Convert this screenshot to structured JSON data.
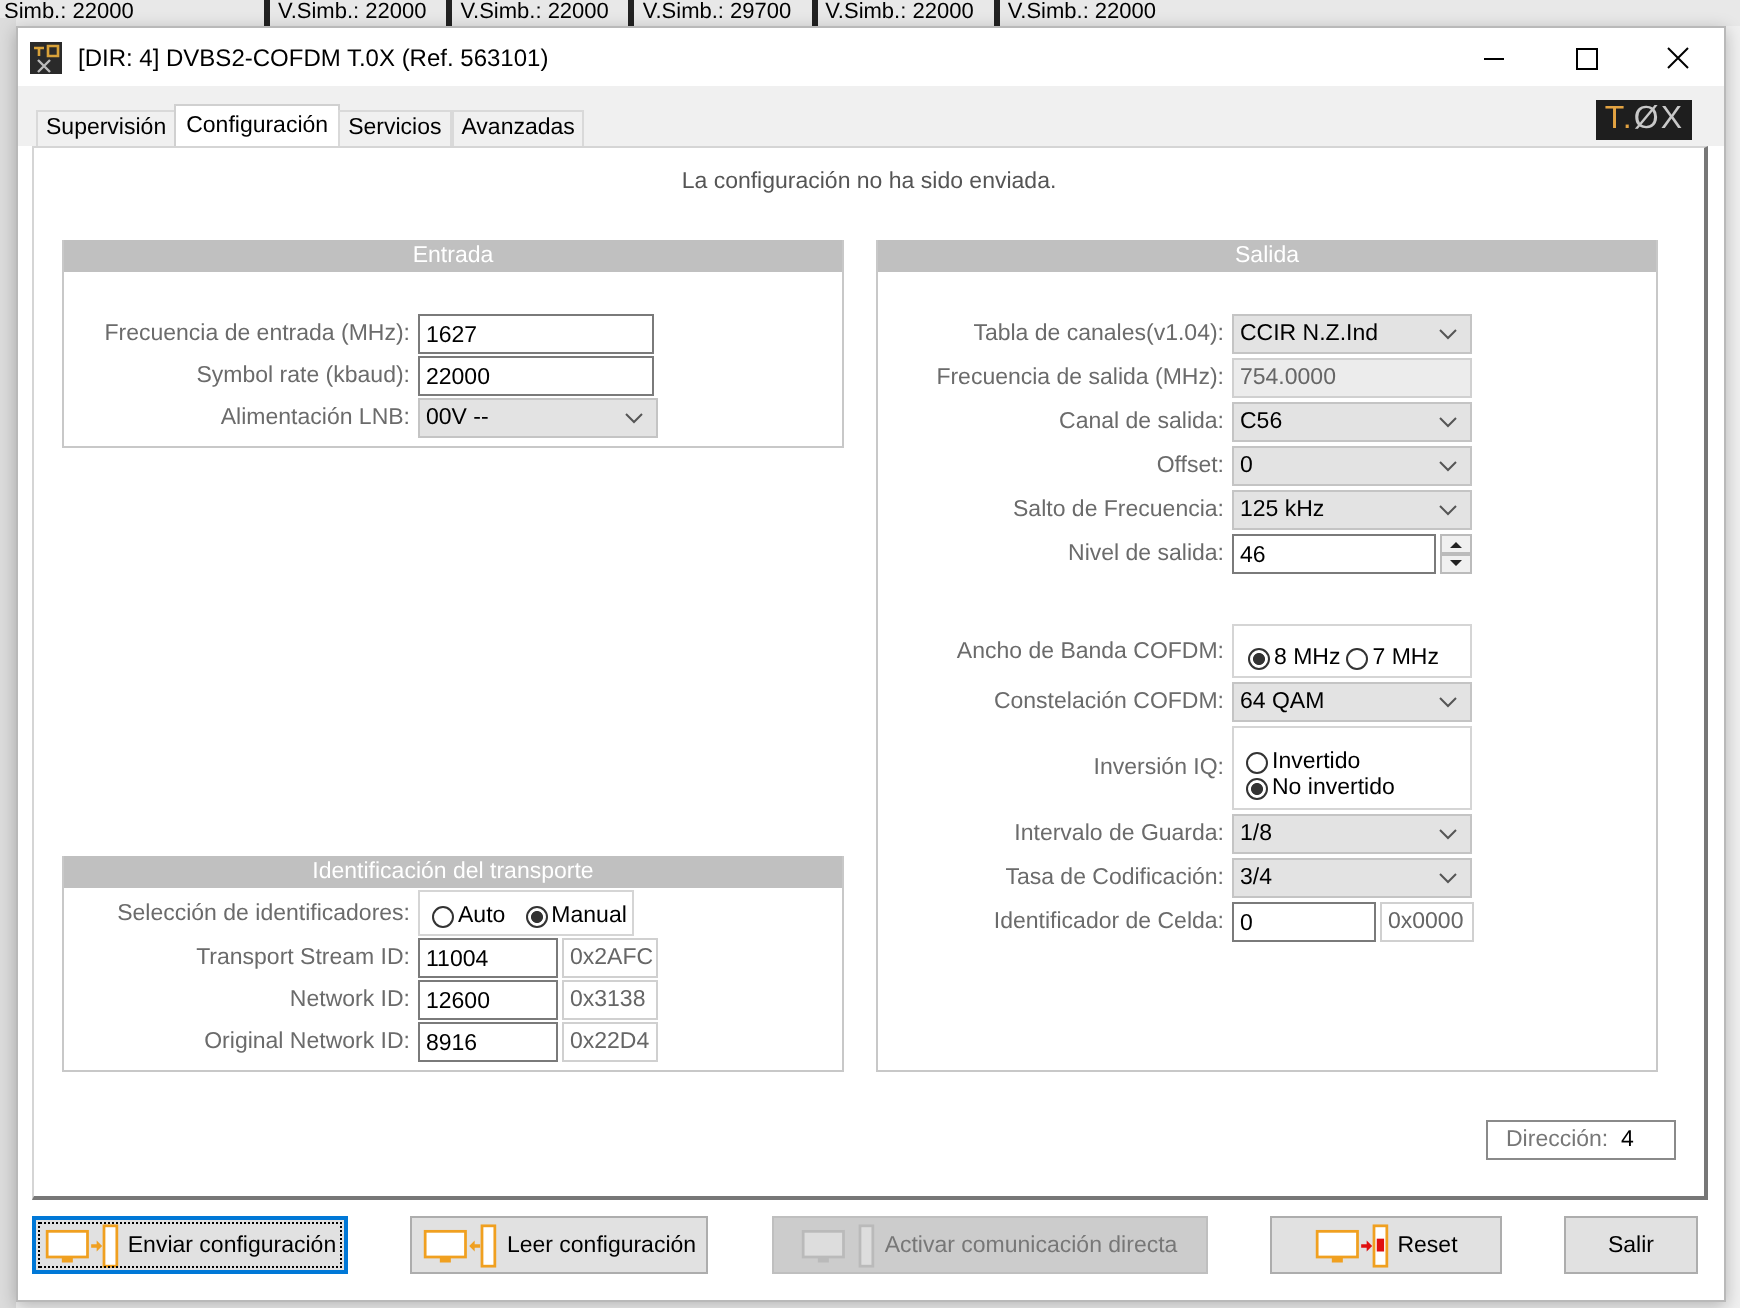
{
  "background": {
    "status_items": [
      "Simb.: 22000",
      "V.Simb.: 22000",
      "V.Simb.: 22000",
      "V.Simb.: 29700",
      "V.Simb.: 22000",
      "V.Simb.: 22000"
    ]
  },
  "window": {
    "title": "[DIR: 4]  DVBS2-COFDM T.0X (Ref. 563101)"
  },
  "logo": {
    "prefix": "T.",
    "suffix": "ØX"
  },
  "tabs": [
    {
      "label": "Supervisión",
      "selected": false
    },
    {
      "label": "Configuración",
      "selected": true
    },
    {
      "label": "Servicios",
      "selected": false
    },
    {
      "label": "Avanzadas",
      "selected": false
    }
  ],
  "status_message": "La configuración no ha sido enviada.",
  "entrada": {
    "title": "Entrada",
    "rows": [
      {
        "kind": "input",
        "label": "Frecuencia de entrada (MHz):",
        "value": "1627"
      },
      {
        "kind": "input",
        "label": "Symbol rate (kbaud):",
        "value": "22000"
      },
      {
        "kind": "select",
        "label": "Alimentación LNB:",
        "value": "00V --"
      }
    ]
  },
  "transporte": {
    "title": "Identificación del transporte",
    "rows": [
      {
        "kind": "radio_row",
        "label": "Selección de identificadores:",
        "options": [
          {
            "label": "Auto",
            "selected": false
          },
          {
            "label": "Manual",
            "selected": true
          }
        ]
      },
      {
        "kind": "hex",
        "label": "Transport Stream ID:",
        "value": "11004",
        "hex": "0x2AFC"
      },
      {
        "kind": "hex",
        "label": "Network ID:",
        "value": "12600",
        "hex": "0x3138"
      },
      {
        "kind": "hex",
        "label": "Original Network ID:",
        "value": "8916",
        "hex": "0x22D4"
      }
    ]
  },
  "salida": {
    "title": "Salida",
    "groups": [
      [
        {
          "kind": "select",
          "label": "Tabla de canales(v1.04):",
          "value": "CCIR N.Z.Ind"
        },
        {
          "kind": "readonly",
          "label": "Frecuencia de salida (MHz):",
          "value": "754.0000"
        },
        {
          "kind": "select",
          "label": "Canal de salida:",
          "value": "C56"
        },
        {
          "kind": "select",
          "label": "Offset:",
          "value": "0"
        },
        {
          "kind": "select",
          "label": "Salto de Frecuencia:",
          "value": "125 kHz"
        },
        {
          "kind": "spinner",
          "label": "Nivel de salida:",
          "value": "46"
        }
      ],
      [
        {
          "kind": "radio_row",
          "label": "Ancho de Banda COFDM:",
          "options": [
            {
              "label": "8 MHz",
              "selected": true
            },
            {
              "label": "7 MHz",
              "selected": false
            }
          ]
        },
        {
          "kind": "select",
          "label": "Constelación COFDM:",
          "value": "64 QAM"
        },
        {
          "kind": "radio_column",
          "label": "Inversión IQ:",
          "options": [
            {
              "label": "Invertido",
              "selected": false
            },
            {
              "label": "No invertido",
              "selected": true
            }
          ]
        },
        {
          "kind": "select",
          "label": "Intervalo de Guarda:",
          "value": "1/8"
        },
        {
          "kind": "select",
          "label": "Tasa de Codificación:",
          "value": "3/4"
        },
        {
          "kind": "hex",
          "label": "Identificador de Celda:",
          "value": "0",
          "hex": "0x0000"
        }
      ]
    ]
  },
  "direccion": {
    "label": "Dirección:",
    "value": "4"
  },
  "buttons": [
    {
      "label": "Enviar configuración",
      "kind": "send",
      "disabled": false,
      "focused": true
    },
    {
      "label": "Leer configuración",
      "kind": "read",
      "disabled": false,
      "focused": false
    },
    {
      "label": "Activar comunicación directa",
      "kind": "direct",
      "disabled": true,
      "focused": false
    },
    {
      "label": "Reset",
      "kind": "reset",
      "disabled": false,
      "focused": false
    },
    {
      "label": "Salir",
      "kind": "plain",
      "disabled": false,
      "focused": false
    }
  ]
}
